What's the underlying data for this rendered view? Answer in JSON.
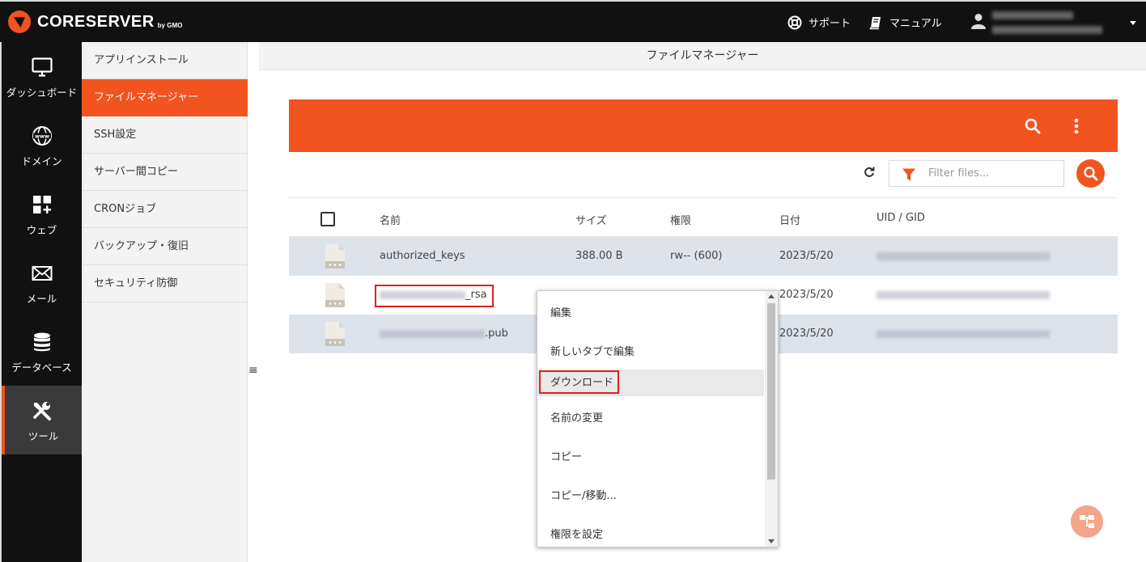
{
  "header": {
    "brand": "CORESERVER",
    "brand_sub": "by GMO",
    "support_label": "サポート",
    "manual_label": "マニュアル"
  },
  "leftnav": [
    {
      "label": "ダッシュボード",
      "icon": "monitor-icon"
    },
    {
      "label": "ドメイン",
      "icon": "globe-www-icon"
    },
    {
      "label": "ウェブ",
      "icon": "grid-plus-icon"
    },
    {
      "label": "メール",
      "icon": "envelope-icon"
    },
    {
      "label": "データベース",
      "icon": "database-icon"
    },
    {
      "label": "ツール",
      "icon": "tools-icon",
      "active": true
    }
  ],
  "submenu": [
    {
      "label": "アプリインストール"
    },
    {
      "label": "ファイルマネージャー",
      "active": true
    },
    {
      "label": "SSH設定"
    },
    {
      "label": "サーバー間コピー"
    },
    {
      "label": "CRONジョブ"
    },
    {
      "label": "バックアップ・復旧"
    },
    {
      "label": "セキュリティ防御"
    }
  ],
  "page": {
    "title": "ファイルマネージャー"
  },
  "filter": {
    "placeholder": "Filter files..."
  },
  "table": {
    "columns": {
      "name": "名前",
      "size": "サイズ",
      "perm": "権限",
      "date": "日付",
      "uid": "UID / GID"
    },
    "rows": [
      {
        "name": "authorized_keys",
        "size": "388.00 B",
        "perm": "rw-- (600)",
        "date": "2023/5/20"
      },
      {
        "name_suffix": "_rsa",
        "size": "",
        "perm": "",
        "date": "2023/5/20"
      },
      {
        "name_suffix": ".pub",
        "size": "",
        "perm": "",
        "date": "2023/5/20"
      }
    ]
  },
  "context_menu": {
    "items": [
      {
        "label": "編集"
      },
      {
        "label": "新しいタブで編集"
      },
      {
        "label": "ダウンロード",
        "highlighted": true
      },
      {
        "label": "名前の変更"
      },
      {
        "label": "コピー"
      },
      {
        "label": "コピー/移動..."
      },
      {
        "label": "権限を設定"
      }
    ]
  },
  "colors": {
    "accent": "#f1541f",
    "topbar": "#111111",
    "row_shade": "#dde3eb",
    "highlight_box": "#e02020"
  }
}
